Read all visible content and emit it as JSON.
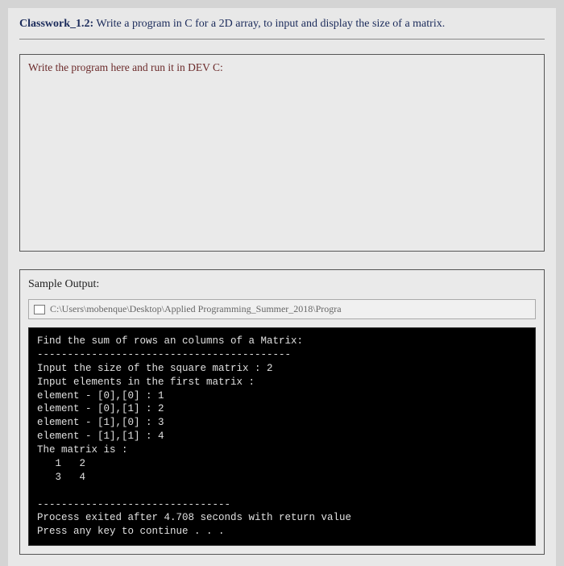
{
  "task": {
    "label": "Classwork_1.2:",
    "text": " Write a program in C for a 2D array, to input and display the size of a matrix."
  },
  "writebox": {
    "prompt": "Write the program here and run it in DEV C:"
  },
  "sample": {
    "title": "Sample Output:",
    "path": "C:\\Users\\mobenque\\Desktop\\Applied Programming_Summer_2018\\Progra",
    "console_lines": [
      "Find the sum of rows an columns of a Matrix:",
      "------------------------------------------",
      "Input the size of the square matrix : 2",
      "Input elements in the first matrix :",
      "element - [0],[0] : 1",
      "element - [0],[1] : 2",
      "element - [1],[0] : 3",
      "element - [1],[1] : 4",
      "The matrix is :",
      "   1   2",
      "   3   4",
      "",
      "--------------------------------",
      "Process exited after 4.708 seconds with return value",
      "Press any key to continue . . ."
    ]
  }
}
